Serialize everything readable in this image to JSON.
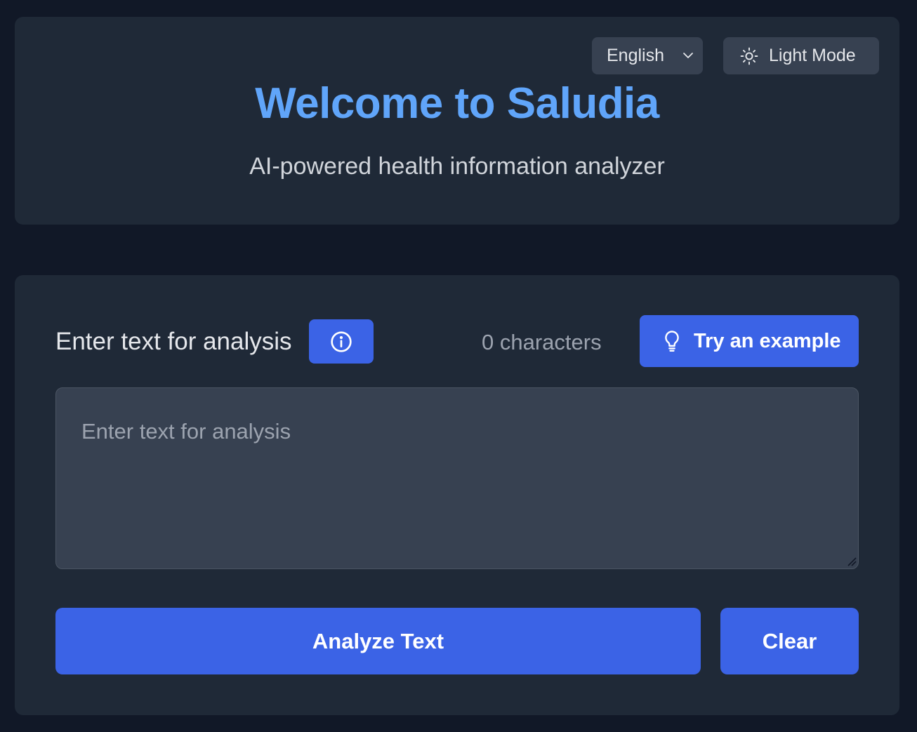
{
  "header": {
    "language": {
      "selected": "English",
      "icon": "chevron-down-icon"
    },
    "mode_toggle": {
      "label": "Light Mode",
      "icon": "sun-icon"
    },
    "title": "Welcome to Saludia",
    "subtitle": "AI-powered health information analyzer"
  },
  "analysis": {
    "label": "Enter text for analysis",
    "info_icon": "info-icon",
    "char_count": "0 characters",
    "example_button": {
      "label": "Try an example",
      "icon": "lightbulb-icon"
    },
    "textarea": {
      "value": "",
      "placeholder": "Enter text for analysis"
    },
    "analyze_button": "Analyze Text",
    "clear_button": "Clear"
  },
  "colors": {
    "page_bg": "#111827",
    "card_bg": "#1f2937",
    "control_bg": "#374151",
    "accent": "#3b63e6",
    "title": "#60a5fa"
  }
}
